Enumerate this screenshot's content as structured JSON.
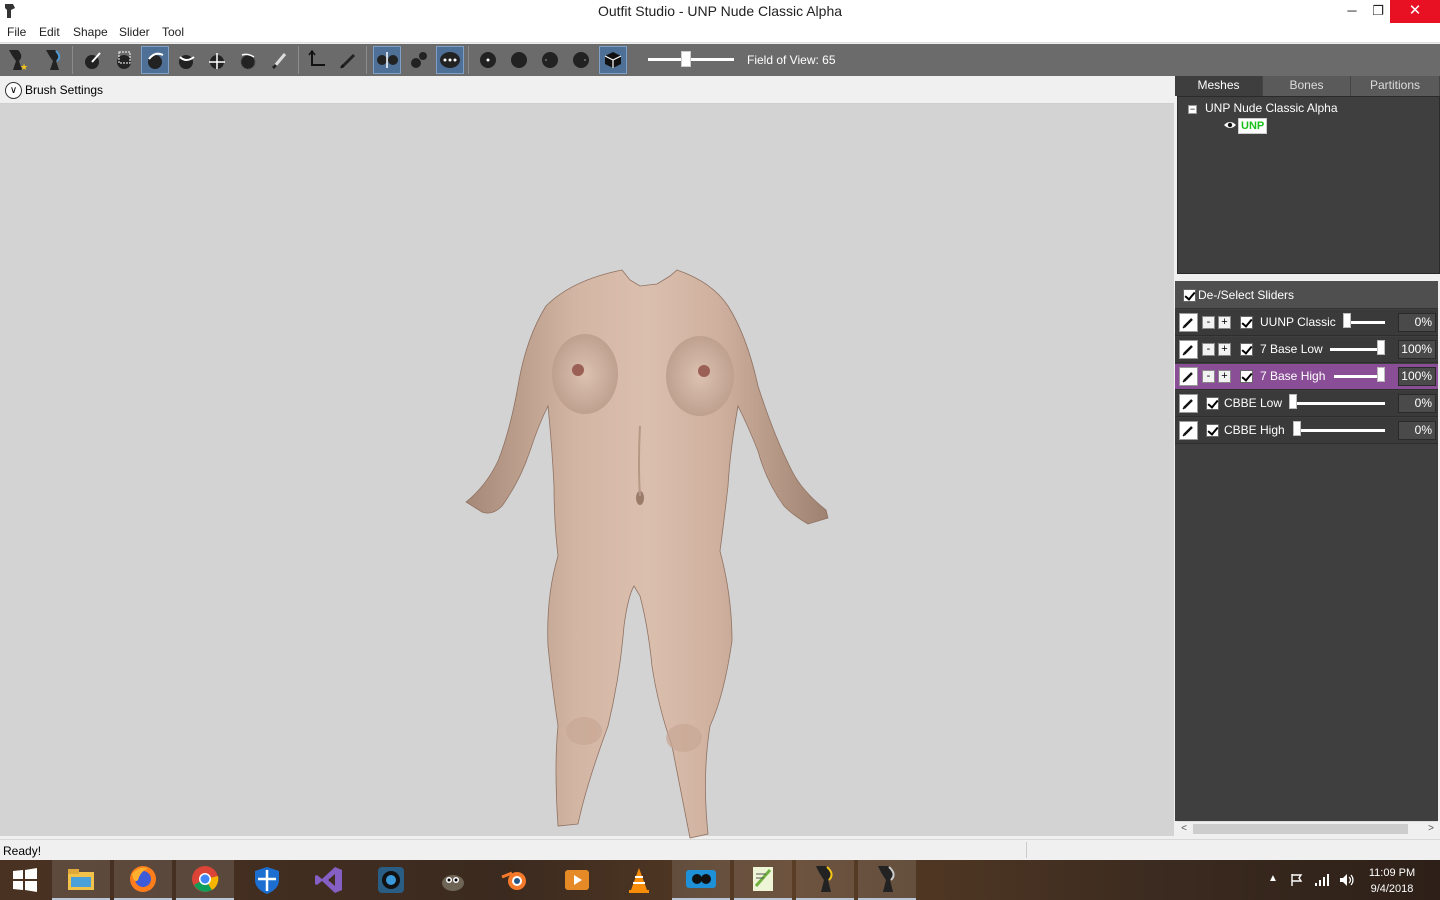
{
  "window": {
    "title": "Outfit Studio - UNP Nude Classic Alpha",
    "minimize": "─",
    "maximize": "❐",
    "close": "✕"
  },
  "menu": [
    "File",
    "Edit",
    "Shape",
    "Slider",
    "Tool"
  ],
  "toolbar": {
    "field_of_view_label": "Field of View: 65",
    "field_of_view_level": 0.4
  },
  "brush_settings": {
    "label": "Brush Settings",
    "toggle_glyph": "∨"
  },
  "tabs": [
    {
      "label": "Meshes",
      "active": true
    },
    {
      "label": "Bones",
      "active": false
    },
    {
      "label": "Partitions",
      "active": false
    }
  ],
  "mesh_tree": {
    "root": "UNP Nude Classic Alpha",
    "mesh": "UNP"
  },
  "sliders_panel": {
    "header": "De-/Select Sliders",
    "rows": [
      {
        "name": "UUNP Classic",
        "value": "0%",
        "fraction": 0.0,
        "has_pm": true,
        "highlight": false
      },
      {
        "name": "7 Base Low",
        "value": "100%",
        "fraction": 1.0,
        "has_pm": true,
        "highlight": false
      },
      {
        "name": "7 Base High",
        "value": "100%",
        "fraction": 1.0,
        "has_pm": true,
        "highlight": true
      },
      {
        "name": "CBBE Low",
        "value": "0%",
        "fraction": 0.0,
        "has_pm": false,
        "highlight": false
      },
      {
        "name": "CBBE High",
        "value": "0%",
        "fraction": 0.0,
        "has_pm": false,
        "highlight": false
      }
    ]
  },
  "status": {
    "text": "Ready!"
  },
  "taskbar": {
    "time": "11:09 PM",
    "date": "9/4/2018"
  },
  "colors": {
    "toolbar_bg": "#6b6b6b",
    "active_tool": "#4e6f96",
    "viewport_bg": "#d3d3d3",
    "panel_bg": "#3f3f3f",
    "slider_highlight": "#8a4e96",
    "mesh_badge": "#1ac01a",
    "close_button": "#e81123"
  }
}
